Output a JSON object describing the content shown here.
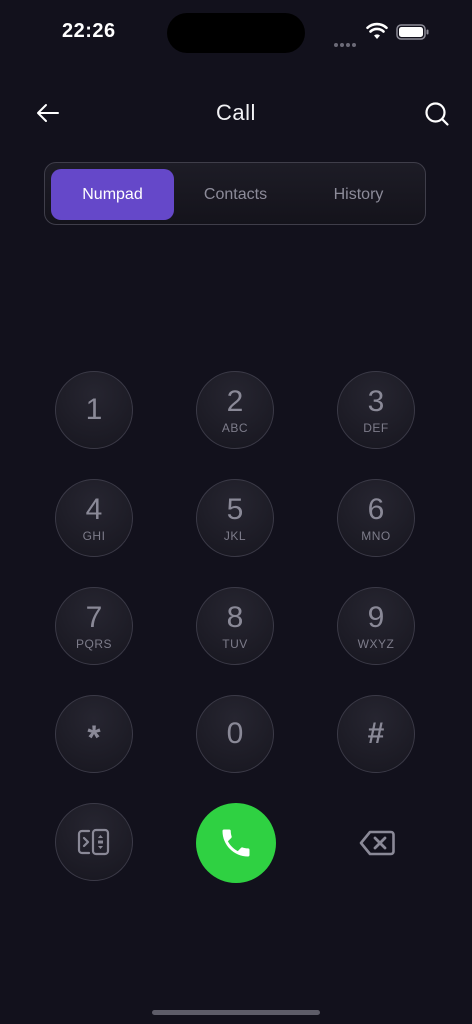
{
  "status_bar": {
    "time": "22:26"
  },
  "header": {
    "title": "Call"
  },
  "tabs": [
    {
      "label": "Numpad",
      "active": true
    },
    {
      "label": "Contacts",
      "active": false
    },
    {
      "label": "History",
      "active": false
    }
  ],
  "keypad": {
    "keys": [
      {
        "digit": "1",
        "letters": ""
      },
      {
        "digit": "2",
        "letters": "ABC"
      },
      {
        "digit": "3",
        "letters": "DEF"
      },
      {
        "digit": "4",
        "letters": "GHI"
      },
      {
        "digit": "5",
        "letters": "JKL"
      },
      {
        "digit": "6",
        "letters": "MNO"
      },
      {
        "digit": "7",
        "letters": "PQRS"
      },
      {
        "digit": "8",
        "letters": "TUV"
      },
      {
        "digit": "9",
        "letters": "WXYZ"
      },
      {
        "digit": "*",
        "letters": ""
      },
      {
        "digit": "0",
        "letters": ""
      },
      {
        "digit": "#",
        "letters": ""
      }
    ]
  },
  "icons": {
    "back": "arrow-left-icon",
    "search": "search-icon",
    "call": "phone-icon",
    "swap": "switch-keypad-icon",
    "delete": "backspace-icon"
  },
  "colors": {
    "background": "#12111c",
    "active_tab": "#6548c9",
    "call_button": "#2fd142",
    "key_text": "#8a8997"
  }
}
